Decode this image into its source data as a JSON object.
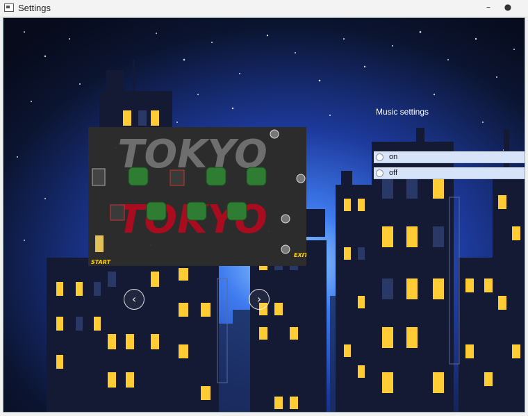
{
  "window": {
    "title": "Settings",
    "minimize_glyph": "–",
    "close_glyph": "●"
  },
  "music": {
    "label": "Music settings",
    "options": [
      {
        "label": "on"
      },
      {
        "label": "off"
      }
    ],
    "selected": null
  },
  "level_preview": {
    "title_top": "TOKYO",
    "title_bottom": "TOKYO",
    "start_label": "START",
    "exit_label": "EXIT",
    "colors": {
      "title_top": "#6e6e6e",
      "title_bottom": "#a80c1e",
      "floor": "#2c2c2c",
      "bush": "#2e7d32"
    }
  },
  "nav": {
    "prev_glyph": "‹",
    "next_glyph": "›"
  },
  "colors": {
    "sky_top": "#0b1430",
    "sky_glow": "#3f7cf0",
    "window_lit": "#ffcc33",
    "radio_bg": "#d6e3f8"
  }
}
